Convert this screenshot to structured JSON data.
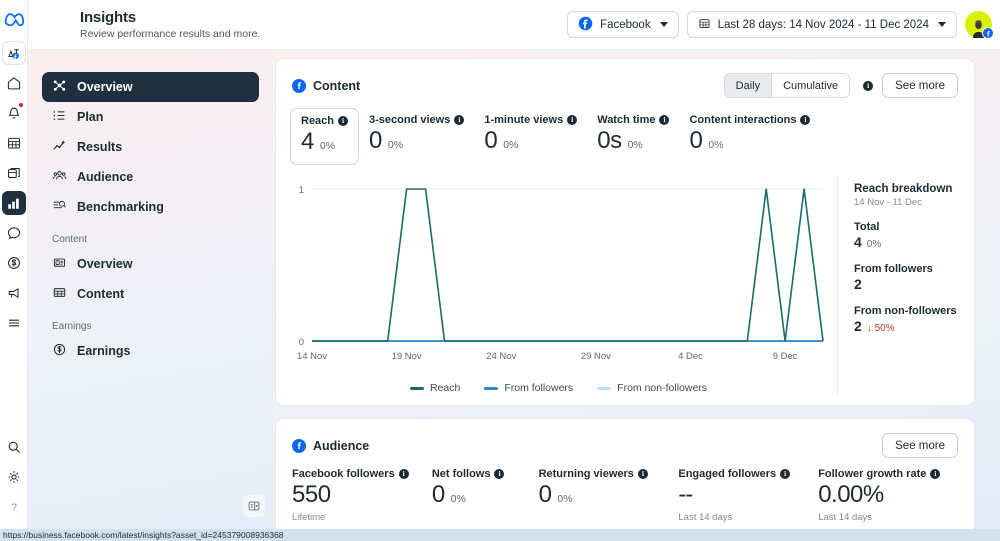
{
  "rail": {
    "logo": "meta-logo",
    "items": [
      {
        "name": "business-account-icon",
        "icon": "business-account"
      },
      {
        "name": "home-icon",
        "icon": "home"
      },
      {
        "name": "notifications-icon",
        "icon": "bell",
        "badge": true
      },
      {
        "name": "calendar-icon",
        "icon": "calendar"
      },
      {
        "name": "pages-icon",
        "icon": "pages"
      },
      {
        "name": "insights-icon",
        "icon": "bar-chart",
        "active": true
      },
      {
        "name": "messages-icon",
        "icon": "chat-bubble"
      },
      {
        "name": "monetization-icon",
        "icon": "dollar-circle"
      },
      {
        "name": "ads-icon",
        "icon": "megaphone"
      },
      {
        "name": "more-icon",
        "icon": "hamburger"
      }
    ],
    "bottom_items": [
      {
        "name": "search-icon",
        "icon": "magnifier"
      },
      {
        "name": "settings-icon",
        "icon": "gear"
      },
      {
        "name": "help-icon",
        "icon": "question-mark"
      }
    ]
  },
  "header": {
    "title": "Insights",
    "subtitle": "Review performance results and more.",
    "platform_pill": "Facebook",
    "date_pill": "Last 28 days: 14 Nov 2024 - 11 Dec 2024"
  },
  "sidebar": {
    "items": [
      {
        "label": "Overview",
        "icon": "overview-nodes",
        "active": true
      },
      {
        "label": "Plan",
        "icon": "list-plan",
        "active": false
      },
      {
        "label": "Results",
        "icon": "trend-line",
        "active": false
      },
      {
        "label": "Audience",
        "icon": "people",
        "active": false
      },
      {
        "label": "Benchmarking",
        "icon": "benchmark-search",
        "active": false
      }
    ],
    "group_content_label": "Content",
    "content_items": [
      {
        "label": "Overview",
        "icon": "content-overview"
      },
      {
        "label": "Content",
        "icon": "table-grid"
      }
    ],
    "group_earnings_label": "Earnings",
    "earnings_items": [
      {
        "label": "Earnings",
        "icon": "dollar-circle"
      }
    ]
  },
  "content_card": {
    "title": "Content",
    "toggle": {
      "options": [
        "Daily",
        "Cumulative"
      ],
      "selected": "Daily"
    },
    "see_more": "See more",
    "metrics": [
      {
        "label": "Reach",
        "value": "4",
        "delta": "0%",
        "selected": true
      },
      {
        "label": "3-second views",
        "value": "0",
        "delta": "0%",
        "selected": false
      },
      {
        "label": "1-minute views",
        "value": "0",
        "delta": "0%",
        "selected": false
      },
      {
        "label": "Watch time",
        "value": "0s",
        "delta": "0%",
        "selected": false
      },
      {
        "label": "Content interactions",
        "value": "0",
        "delta": "0%",
        "selected": false
      }
    ],
    "breakdown": {
      "title": "Reach breakdown",
      "range": "14 Nov - 11 Dec",
      "total_label": "Total",
      "total_value": "4",
      "total_delta": "0%",
      "followers_label": "From followers",
      "followers_value": "2",
      "nonfollowers_label": "From non-followers",
      "nonfollowers_value": "2",
      "nonfollowers_delta": "50%",
      "nonfollowers_dir": "down"
    }
  },
  "chart_data": {
    "type": "line",
    "title": "Reach",
    "xlabel": "",
    "ylabel": "",
    "ylim": [
      0,
      1
    ],
    "ytick_labels": [
      "0",
      "1"
    ],
    "grid": true,
    "legend_position": "bottom",
    "x": [
      "14 Nov",
      "15 Nov",
      "16 Nov",
      "17 Nov",
      "18 Nov",
      "19 Nov",
      "20 Nov",
      "21 Nov",
      "22 Nov",
      "23 Nov",
      "24 Nov",
      "25 Nov",
      "26 Nov",
      "27 Nov",
      "28 Nov",
      "29 Nov",
      "30 Nov",
      "1 Dec",
      "2 Dec",
      "3 Dec",
      "4 Dec",
      "5 Dec",
      "6 Dec",
      "7 Dec",
      "8 Dec",
      "9 Dec",
      "10 Dec",
      "11 Dec"
    ],
    "xtick_labels": [
      "14 Nov",
      "19 Nov",
      "24 Nov",
      "29 Nov",
      "4 Dec",
      "9 Dec"
    ],
    "xtick_indices": [
      0,
      5,
      10,
      15,
      20,
      25
    ],
    "series": [
      {
        "name": "Reach",
        "color": "#1a6b6b",
        "values": [
          0,
          0,
          0,
          0,
          0,
          1,
          1,
          0,
          0,
          0,
          0,
          0,
          0,
          0,
          0,
          0,
          0,
          0,
          0,
          0,
          0,
          0,
          0,
          0,
          1,
          0,
          1,
          0
        ]
      },
      {
        "name": "From followers",
        "color": "#2d87c8",
        "values": [
          0,
          0,
          0,
          0,
          0,
          0,
          0,
          0,
          0,
          0,
          0,
          0,
          0,
          0,
          0,
          0,
          0,
          0,
          0,
          0,
          0,
          0,
          0,
          0,
          0,
          0,
          0,
          0
        ]
      },
      {
        "name": "From non-followers",
        "color": "#b5dff5",
        "values": [
          0,
          0,
          0,
          0,
          0,
          0,
          0,
          0,
          0,
          0,
          0,
          0,
          0,
          0,
          0,
          0,
          0,
          0,
          0,
          0,
          0,
          0,
          0,
          0,
          0,
          0,
          0,
          0
        ]
      }
    ]
  },
  "audience_card": {
    "title": "Audience",
    "see_more": "See more",
    "metrics": [
      {
        "label": "Facebook followers",
        "value": "550",
        "delta": "",
        "footnote": "Lifetime"
      },
      {
        "label": "Net follows",
        "value": "0",
        "delta": "0%",
        "footnote": ""
      },
      {
        "label": "Returning viewers",
        "value": "0",
        "delta": "0%",
        "footnote": ""
      },
      {
        "label": "Engaged followers",
        "value": "--",
        "delta": "",
        "footnote": "Last 14 days"
      },
      {
        "label": "Follower growth rate",
        "value": "0.00%",
        "delta": "",
        "footnote": "Last 14 days"
      }
    ]
  },
  "statusbar": {
    "url": "https://business.facebook.com/latest/insights?asset_id=245379008936368"
  },
  "colors": {
    "accent_blue": "#0866ff",
    "nav_active": "#21303f",
    "reach_line": "#1a6b6b",
    "followers_line": "#2d87c8",
    "nonfollowers_line": "#b5dff5",
    "down_red": "#c0392b",
    "avatar_bg": "#d9f000"
  }
}
